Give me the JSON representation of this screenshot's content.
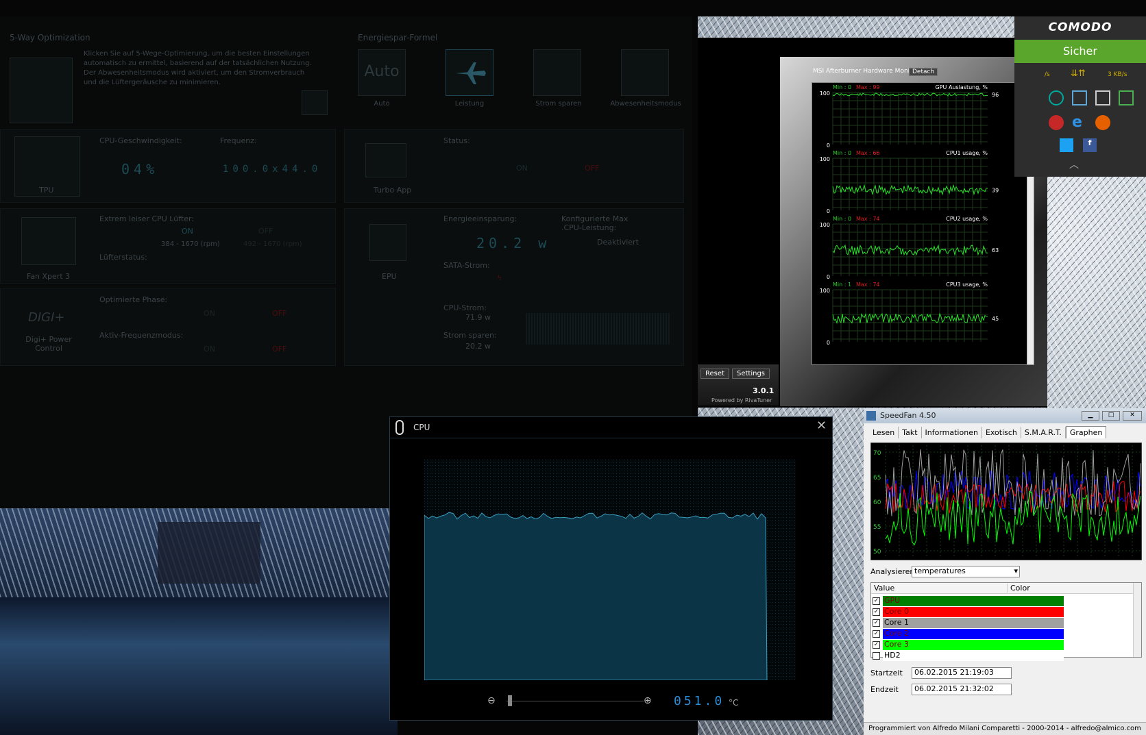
{
  "suite": {
    "five_way_title": "5-Way Optimization",
    "five_way_desc": "Klicken Sie auf 5-Wege-Optimierung, um die besten Einstellungen automatisch zu ermittel, basierend auf der tatsächlichen Nutzung. Der Abwesenheitsmodus wird aktiviert, um den Stromverbrauch und die Lüftergeräusche zu minimieren.",
    "energy_title": "Energiespar-Formel",
    "modes": [
      {
        "top": "Auto",
        "label": "Auto"
      },
      {
        "label": "Leistung"
      },
      {
        "label": "Strom sparen"
      },
      {
        "label": "Abwesenheitsmodus"
      }
    ],
    "tpu": {
      "label": "TPU",
      "cpu_speed_label": "CPU-Geschwindigkeit:",
      "cpu_speed_value": "04%",
      "freq_label": "Frequenz:",
      "freq_value": "100.0x44.0"
    },
    "turbo": {
      "label": "Turbo App",
      "status_label": "Status:",
      "on": "ON",
      "off": "OFF"
    },
    "fan": {
      "label": "Fan Xpert 3",
      "quiet_label": "Extrem leiser CPU Lüfter:",
      "on": "ON",
      "off": "OFF",
      "rpm_on": "384 - 1670 (rpm)",
      "rpm_off": "492 - 1670 (rpm)",
      "fan_status_label": "Lüfterstatus:"
    },
    "epu": {
      "label": "EPU",
      "saving_label": "Energieeinsparung:",
      "saving_value": "20.2 w",
      "max_label": "Konfigurierte Max .CPU-Leistung:",
      "max_value": "Deaktiviert",
      "sata_label": "SATA-Strom:",
      "cpu_power_label": "CPU-Strom:",
      "cpu_power_value": "71.9 w",
      "save_label": "Strom sparen:",
      "save_value": "20.2 w"
    },
    "digi": {
      "logo": "DIGI+",
      "label": "Digi+ Power Control",
      "phase_label": "Optimierte Phase:",
      "freq_mode_label": "Aktiv-Frequenzmodus:",
      "on": "ON",
      "off": "OFF"
    }
  },
  "msi": {
    "title": "MSI Afterburner Hardware Monitor",
    "detach": "Detach",
    "reset": "Reset",
    "settings": "Settings",
    "version": "3.0.1",
    "powered": "Powered by RivaTuner",
    "graphs": [
      {
        "min_label": "Min : 0",
        "max_label": "Max : 99",
        "name": "GPU Auslastung, %",
        "ymax": "100",
        "ymin": "0",
        "value": "96",
        "level": 0.96
      },
      {
        "min_label": "Min : 0",
        "max_label": "Max : 66",
        "name": "CPU1 usage, %",
        "ymax": "100",
        "ymin": "0",
        "value": "39",
        "level": 0.39
      },
      {
        "min_label": "Min : 0",
        "max_label": "Max : 74",
        "name": "CPU2 usage, %",
        "ymax": "100",
        "ymin": "0",
        "value": "63",
        "level": 0.5
      },
      {
        "min_label": "Min : 1",
        "max_label": "Max : 74",
        "name": "CPU3 usage, %",
        "ymax": "100",
        "ymin": "0",
        "value": "45",
        "level": 0.45
      }
    ]
  },
  "comodo": {
    "brand": "COMODO",
    "status": "Sicher",
    "speed_left": "/s",
    "speed_right": "3 KB/s"
  },
  "cpu_window": {
    "title": "CPU",
    "reading": "051.0",
    "unit": "°C"
  },
  "speedfan": {
    "title": "SpeedFan 4.50",
    "tabs": [
      "Lesen",
      "Takt",
      "Informationen",
      "Exotisch",
      "S.M.A.R.T.",
      "Graphen"
    ],
    "y_ticks": [
      "70",
      "65",
      "60",
      "55",
      "50"
    ],
    "analyze_label": "Analysieren",
    "analyze_value": "temperatures",
    "col_value": "Value",
    "col_color": "Color",
    "items": [
      {
        "name": "GPU",
        "color": "#008000"
      },
      {
        "name": "Core 0",
        "color": "#ff0000"
      },
      {
        "name": "Core 1",
        "color": "#a0a0a0"
      },
      {
        "name": "Core 2",
        "color": "#0000ff"
      },
      {
        "name": "Core 3",
        "color": "#00ff00"
      },
      {
        "name": "HD2",
        "color": "#ffffff"
      }
    ],
    "start_label": "Startzeit",
    "start_value": "06.02.2015 21:19:03",
    "end_label": "Endzeit",
    "end_value": "06.02.2015 21:32:02",
    "footer": "Programmiert von Alfredo Milani Comparetti - 2000-2014 - alfredo@almico.com"
  }
}
